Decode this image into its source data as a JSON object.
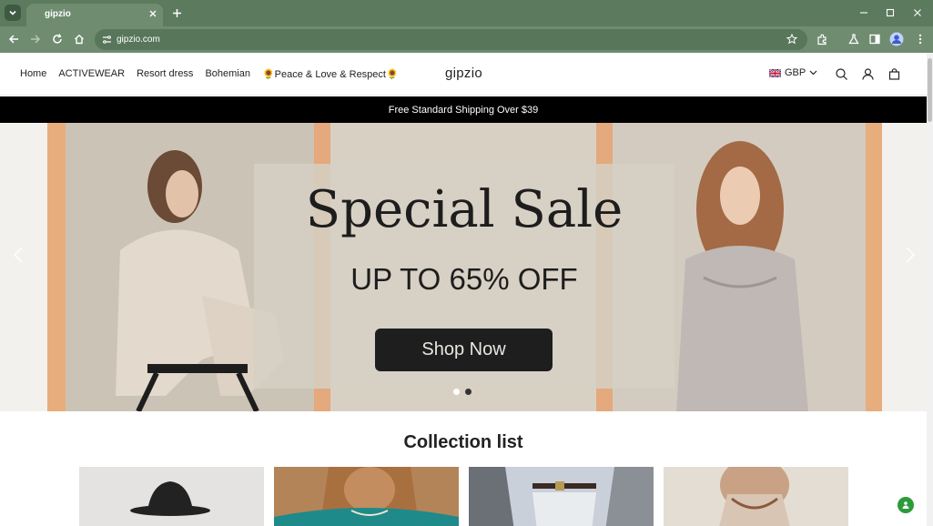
{
  "browser": {
    "tab_title": "gipzio",
    "url": "gipzio.com",
    "accent": "#6f8c70"
  },
  "header": {
    "nav": [
      "Home",
      "ACTIVEWEAR",
      "Resort dress",
      "Bohemian",
      "🌻Peace & Love & Respect🌻"
    ],
    "logo": "gipzio",
    "currency": "GBP"
  },
  "announcement": "Free Standard Shipping Over $39",
  "hero": {
    "title": "Special Sale",
    "subtitle": "UP TO 65% OFF",
    "cta": "Shop Now"
  },
  "collections": {
    "title": "Collection list"
  },
  "icons": [
    "tab-menu-icon",
    "close-icon",
    "plus-icon",
    "minimize-icon",
    "maximize-icon",
    "back-icon",
    "forward-icon",
    "reload-icon",
    "home-icon",
    "site-info-icon",
    "star-icon",
    "extensions-icon",
    "labs-icon",
    "sidepanel-icon",
    "profile-icon",
    "more-icon",
    "search-icon",
    "account-icon",
    "cart-icon",
    "chevron-left-icon",
    "chevron-right-icon",
    "chat-icon"
  ]
}
